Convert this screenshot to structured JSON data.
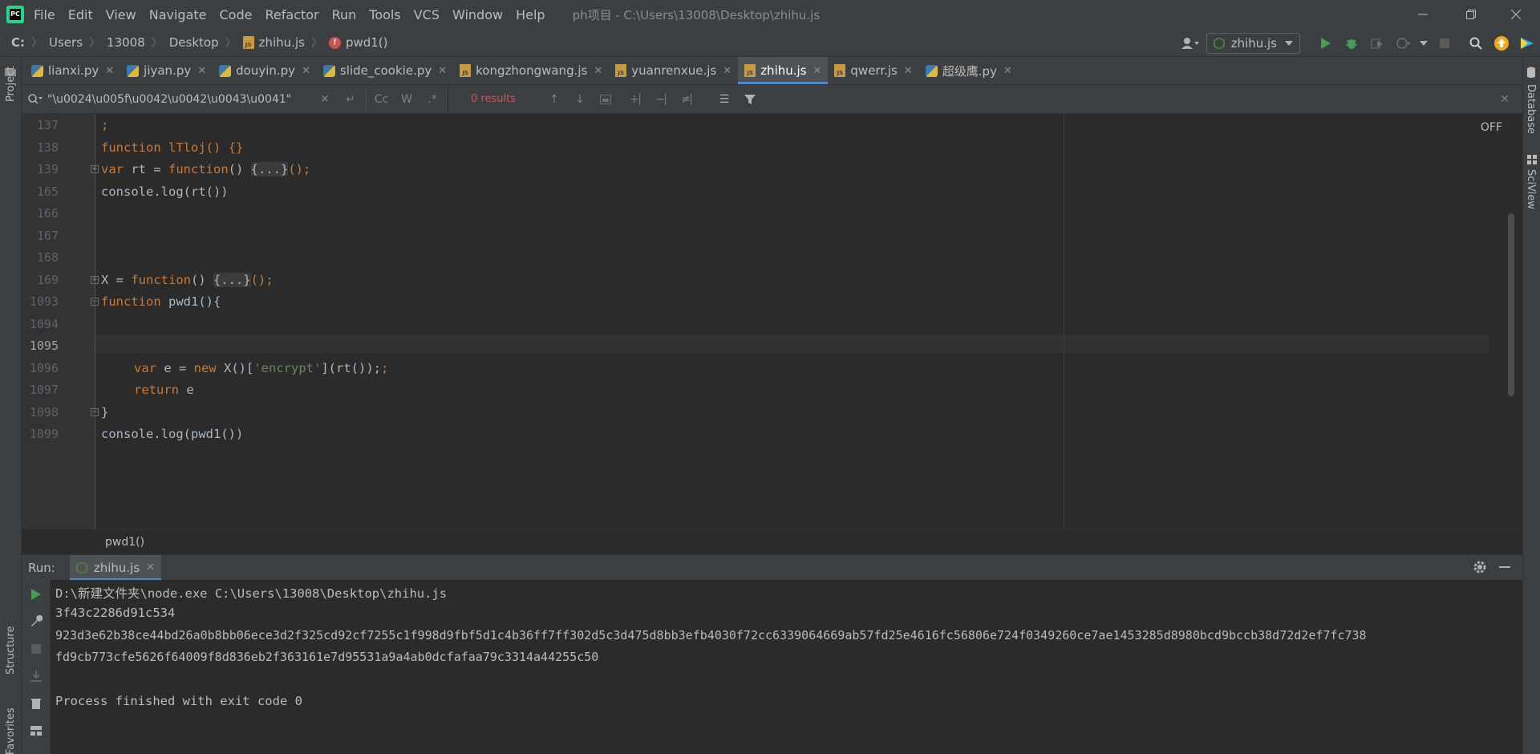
{
  "titlebar": {
    "logo_text": "PC",
    "menu": [
      "File",
      "Edit",
      "View",
      "Navigate",
      "Code",
      "Refactor",
      "Run",
      "Tools",
      "VCS",
      "Window",
      "Help"
    ],
    "window_title": "ph项目 - C:\\Users\\13008\\Desktop\\zhihu.js"
  },
  "navbar": {
    "crumbs": [
      "C:",
      "Users",
      "13008",
      "Desktop",
      "zhihu.js",
      "pwd1()"
    ],
    "run_config": "zhihu.js"
  },
  "tool_windows": {
    "left_top": "Project",
    "left_bottom_1": "Structure",
    "left_bottom_2": "Favorites",
    "right_1": "Database",
    "right_2": "SciView"
  },
  "tabs": [
    {
      "label": "lianxi.py",
      "type": "py",
      "active": false
    },
    {
      "label": "jiyan.py",
      "type": "py",
      "active": false
    },
    {
      "label": "douyin.py",
      "type": "py",
      "active": false
    },
    {
      "label": "slide_cookie.py",
      "type": "py",
      "active": false
    },
    {
      "label": "kongzhongwang.js",
      "type": "js",
      "active": false
    },
    {
      "label": "yuanrenxue.js",
      "type": "js",
      "active": false
    },
    {
      "label": "zhihu.js",
      "type": "js",
      "active": true
    },
    {
      "label": "qwerr.js",
      "type": "js",
      "active": false
    },
    {
      "label": "超级鹰.py",
      "type": "py",
      "active": false
    }
  ],
  "search": {
    "query": "\"\\u0024\\u005f\\u0042\\u0042\\u0043\\u0041\"",
    "results": "0 results",
    "case_label": "Cc",
    "word_label": "W",
    "regex_label": ".*"
  },
  "editor": {
    "off_label": "OFF",
    "line_numbers": [
      "137",
      "138",
      "139",
      "165",
      "166",
      "167",
      "168",
      "169",
      "1093",
      "1094",
      "1095",
      "1096",
      "1097",
      "1098",
      "1099"
    ],
    "code": {
      "l137": ";",
      "l138": "function lTloj() {}",
      "l139_kw": "var",
      "l139_a": " rt = ",
      "l139_fn": "function",
      "l139_b": "() ",
      "l139_fold": "{...}",
      "l139_c": "();",
      "l165": "console.log(rt())",
      "l169_a": "X = ",
      "l169_fn": "function",
      "l169_b": "() ",
      "l169_fold": "{...}",
      "l169_c": "();",
      "l1093_kw": "function",
      "l1093_a": " pwd1(){",
      "l1096_kw1": "var",
      "l1096_a": " e = ",
      "l1096_kw2": "new",
      "l1096_b": " X()[",
      "l1096_str": "'encrypt'",
      "l1096_c": "](rt());",
      "l1097_kw": "return",
      "l1097_a": " e",
      "l1098": "}",
      "l1099": "console.log(pwd1())"
    },
    "footer_crumb": "pwd1()"
  },
  "run_panel": {
    "label": "Run:",
    "tab_label": "zhihu.js",
    "output": [
      "D:\\新建文件夹\\node.exe C:\\Users\\13008\\Desktop\\zhihu.js",
      "3f43c2286d91c534",
      "923d3e62b38ce44bd26a0b8bb06ece3d2f325cd92cf7255c1f998d9fbf5d1c4b36ff7ff302d5c3d475d8bb3efb4030f72cc6339064669ab57fd25e4616fc56806e724f0349260ce7ae1453285d8980bcd9bccb38d72d2ef7fc738",
      "fd9cb773cfe5626f64009f8d836eb2f363161e7d95531a9a4ab0dcfafaa79c3314a44255c50",
      "",
      "Process finished with exit code 0"
    ]
  },
  "colors": {
    "keyword": "#cc7832",
    "string": "#6a8759",
    "accent": "#4a88c7",
    "run_green": "#499c54",
    "results_red": "#d25252"
  }
}
